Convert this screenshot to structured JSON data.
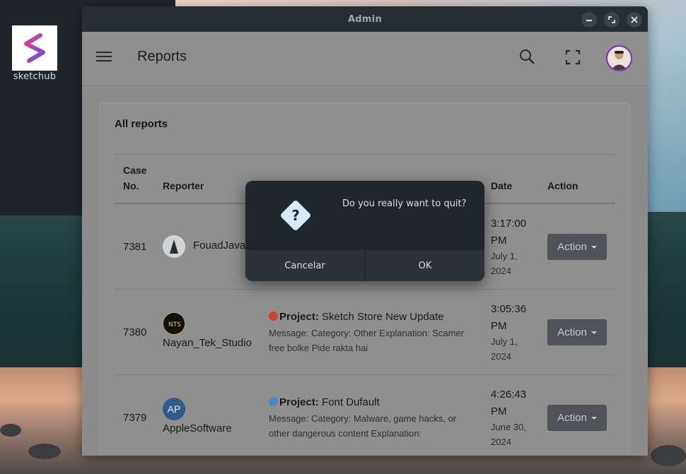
{
  "desktop": {
    "icon_label": "sketchub"
  },
  "window": {
    "title": "Admin"
  },
  "appbar": {
    "title": "Reports"
  },
  "card": {
    "title": "All reports"
  },
  "table": {
    "headers": {
      "case": "Case",
      "case2": "No.",
      "reporter": "Reporter",
      "date": "Date",
      "action": "Action"
    },
    "rows": [
      {
        "case_no": "7381",
        "reporter": "FouadJava",
        "project": "",
        "project_name": "",
        "message": "",
        "time1": "3:17:00",
        "time2": "PM",
        "date": "July 1,",
        "year": "2024",
        "action": "Action"
      },
      {
        "case_no": "7380",
        "reporter": "Nayan_Tek_Studio",
        "project": "Project:",
        "project_name": "Sketch Store New Update",
        "message1": "Message: Category: Other Explanation: Scamer",
        "message2": "free bolke Pide rakta hai",
        "time1": "3:05:36",
        "time2": "PM",
        "date": "July 1,",
        "year": "2024",
        "action": "Action",
        "dot_color": "#c8452c"
      },
      {
        "case_no": "7379",
        "reporter": "AppleSoftware",
        "avatar_text": "AP",
        "project": "Project:",
        "project_name": "Font Dufault",
        "message1": "Message: Category: Malware, game hacks, or",
        "message2": "other dangerous content Explanation:",
        "time1": "4:26:43",
        "time2": "PM",
        "date": "June 30,",
        "year": "2024",
        "action": "Action",
        "dot_color": "#4e86c6"
      }
    ]
  },
  "dialog": {
    "message": "Do you really want to quit?",
    "cancel": "Cancelar",
    "ok": "OK"
  },
  "icons": {
    "menu": "hamburger-icon",
    "search": "search-icon",
    "fullscreen": "fullscreen-icon",
    "question": "question-icon"
  },
  "colors": {
    "accent": "#7b2fb8",
    "action_bg": "#4f5359",
    "dialog_bg": "#20272c"
  }
}
